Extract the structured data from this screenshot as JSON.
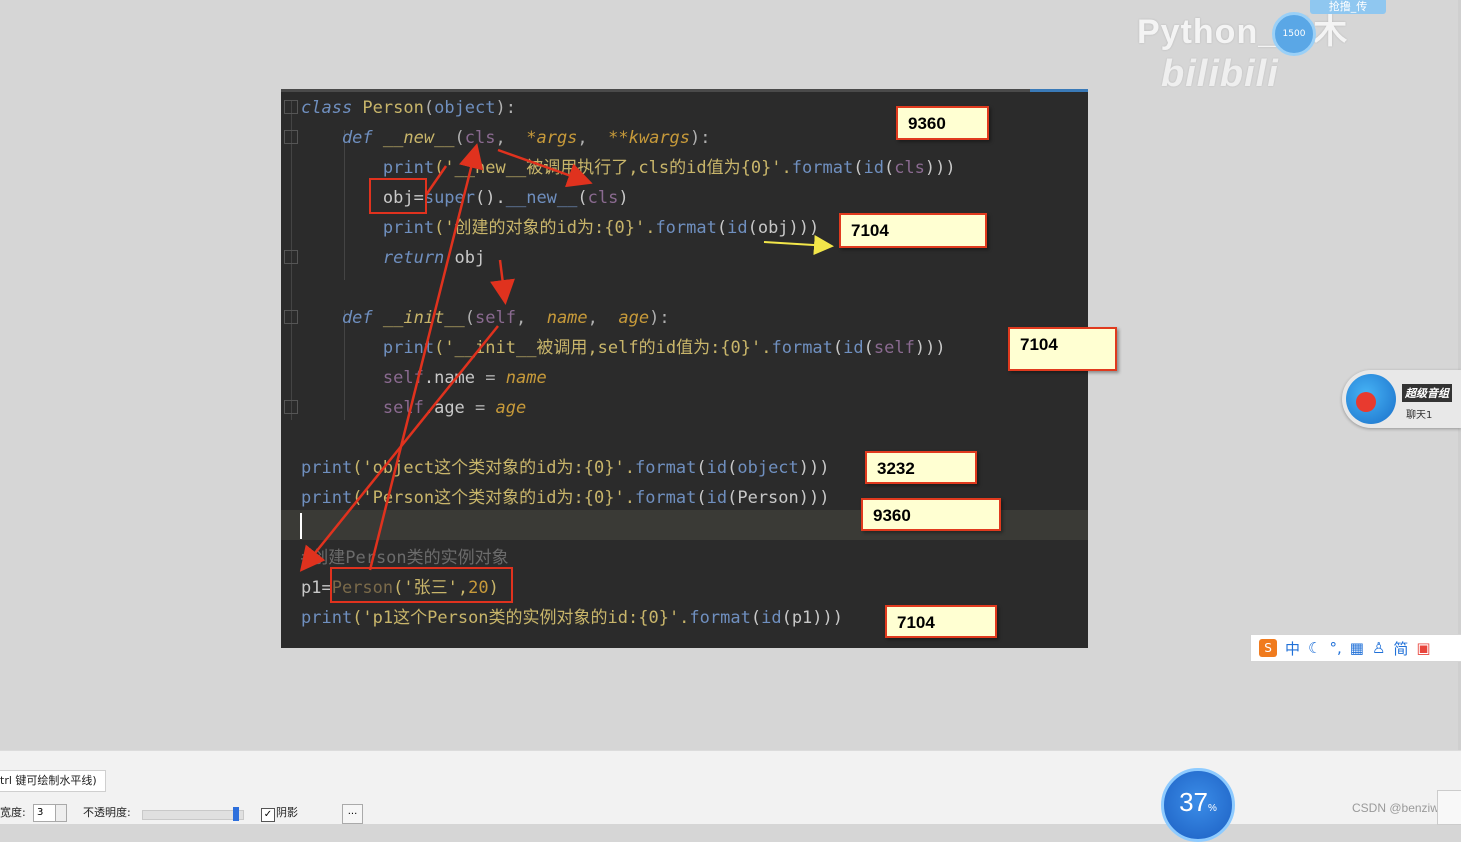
{
  "watermark": {
    "text": "Python_子木",
    "brand": "bilibili",
    "badge": "抢撸_传",
    "circle_text": "1500"
  },
  "code_lines": [
    [
      [
        "kw",
        "class "
      ],
      [
        "cls",
        "Person"
      ],
      [
        "punc",
        "("
      ],
      [
        "bi",
        "object"
      ],
      [
        "punc",
        "):"
      ]
    ],
    [
      [
        "kw",
        "    def "
      ],
      [
        "fn",
        "__new__"
      ],
      [
        "punc",
        "("
      ],
      [
        "self",
        "cls"
      ],
      [
        "punc",
        ",  "
      ],
      [
        "param",
        "*args"
      ],
      [
        "punc",
        ",  "
      ],
      [
        "param",
        "**kwargs"
      ],
      [
        "punc",
        "):"
      ]
    ],
    [
      [
        "plain",
        "        "
      ],
      [
        "bi",
        "print"
      ],
      [
        "str",
        "('__new__被调用执行了,cls的id值为{0}'."
      ],
      [
        "bi",
        "format"
      ],
      [
        "plain",
        "("
      ],
      [
        "bi",
        "id"
      ],
      [
        "plain",
        "("
      ],
      [
        "self",
        "cls"
      ],
      [
        "plain",
        ")))"
      ]
    ],
    [
      [
        "plain",
        "        obj="
      ],
      [
        "bi",
        "super"
      ],
      [
        "plain",
        "()."
      ],
      [
        "bi",
        "__new__"
      ],
      [
        "plain",
        "("
      ],
      [
        "self",
        "cls"
      ],
      [
        "plain",
        ")"
      ]
    ],
    [
      [
        "plain",
        "        "
      ],
      [
        "bi",
        "print"
      ],
      [
        "str",
        "('创建的对象的id为:{0}'."
      ],
      [
        "bi",
        "format"
      ],
      [
        "plain",
        "("
      ],
      [
        "bi",
        "id"
      ],
      [
        "plain",
        "(obj)))"
      ]
    ],
    [
      [
        "kw",
        "        return "
      ],
      [
        "plain",
        "obj"
      ]
    ],
    [],
    [
      [
        "kw",
        "    def "
      ],
      [
        "fn",
        "__init__"
      ],
      [
        "punc",
        "("
      ],
      [
        "self",
        "self"
      ],
      [
        "punc",
        ",  "
      ],
      [
        "param",
        "name"
      ],
      [
        "punc",
        ",  "
      ],
      [
        "param",
        "age"
      ],
      [
        "punc",
        "):"
      ]
    ],
    [
      [
        "plain",
        "        "
      ],
      [
        "bi",
        "print"
      ],
      [
        "str",
        "('__init__被调用,self的id值为:{0}'."
      ],
      [
        "bi",
        "format"
      ],
      [
        "plain",
        "("
      ],
      [
        "bi",
        "id"
      ],
      [
        "plain",
        "("
      ],
      [
        "self",
        "self"
      ],
      [
        "plain",
        ")))"
      ]
    ],
    [
      [
        "plain",
        "        "
      ],
      [
        "self",
        "self"
      ],
      [
        "plain",
        ".name "
      ],
      [
        "punc",
        "= "
      ],
      [
        "param",
        "name"
      ]
    ],
    [
      [
        "plain",
        "        "
      ],
      [
        "self",
        "self"
      ],
      [
        "plain",
        ".age "
      ],
      [
        "punc",
        "= "
      ],
      [
        "param",
        "age"
      ]
    ],
    [],
    [
      [
        "bi",
        "print"
      ],
      [
        "str",
        "('object这个类对象的id为:{0}'."
      ],
      [
        "bi",
        "format"
      ],
      [
        "plain",
        "("
      ],
      [
        "bi",
        "id"
      ],
      [
        "plain",
        "("
      ],
      [
        "bi",
        "object"
      ],
      [
        "plain",
        ")))"
      ]
    ],
    [
      [
        "bi",
        "print"
      ],
      [
        "str",
        "('Person这个类对象的id为:{0}'."
      ],
      [
        "bi",
        "format"
      ],
      [
        "plain",
        "("
      ],
      [
        "bi",
        "id"
      ],
      [
        "plain",
        "(Person)))"
      ]
    ],
    [],
    [
      [
        "comment",
        "#创建Person类的实例对象"
      ]
    ],
    [
      [
        "plain",
        "p1="
      ],
      [
        "dim",
        "Person"
      ],
      [
        "str",
        "('张三',"
      ],
      [
        "num",
        "20"
      ],
      [
        "str",
        ")"
      ]
    ],
    [
      [
        "bi",
        "print"
      ],
      [
        "str",
        "('p1这个Person类的实例对象的id:{0}'."
      ],
      [
        "bi",
        "format"
      ],
      [
        "plain",
        "("
      ],
      [
        "bi",
        "id"
      ],
      [
        "plain",
        "(p1)))"
      ]
    ]
  ],
  "annotations": {
    "cls_id": "9360",
    "obj_id": "7104",
    "self_id": "7104",
    "object_id": "3232",
    "person_id": "9360",
    "p1_id": "7104"
  },
  "chat_widget": {
    "title": "超级音组",
    "subtitle": "聊天1"
  },
  "ime_bar": {
    "lang": "中",
    "simplified": "简"
  },
  "bottom": {
    "tab_label": "trl 键可绘制水平线)",
    "width_label": "宽度:",
    "width_value": "3",
    "opacity_label": "不透明度:",
    "shadow_label": "阴影",
    "more_label": "...",
    "shadow_checked": true,
    "opacity_level": 0.93
  },
  "progress": {
    "value": "37",
    "unit": "%"
  },
  "credit": "CSDN @benziwu",
  "colors": {
    "editor_bg": "#2b2b2b",
    "annotation_bg": "#ffffd2",
    "arrow_red": "#e0321e",
    "arrow_yellow": "#f2e64a"
  }
}
